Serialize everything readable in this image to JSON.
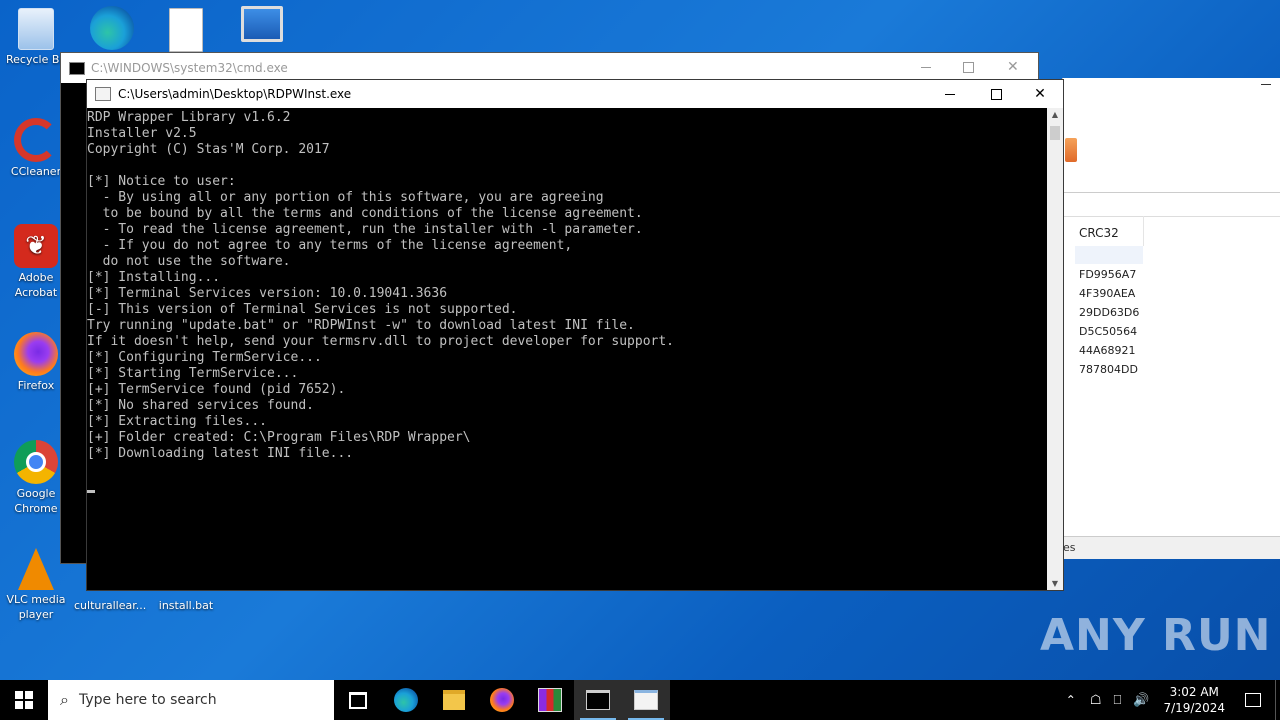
{
  "desktop_icons": [
    {
      "label": "Recycle Bin",
      "icon": "recycle-bin-icon"
    },
    {
      "label": "CCleaner",
      "icon": "ccleaner-icon"
    },
    {
      "label": "Adobe Acrobat",
      "icon": "acrobat-icon"
    },
    {
      "label": "Firefox",
      "icon": "firefox-icon"
    },
    {
      "label": "Google Chrome",
      "icon": "chrome-icon"
    },
    {
      "label": "VLC media player",
      "icon": "vlc-icon"
    },
    {
      "label": "culturallear...",
      "icon": "file-icon"
    },
    {
      "label": "install.bat",
      "icon": "bat-file-icon"
    }
  ],
  "back_window": {
    "title": "C:\\WINDOWS\\system32\\cmd.exe"
  },
  "front_window": {
    "title": "C:\\Users\\admin\\Desktop\\RDPWInst.exe",
    "console_lines": [
      "RDP Wrapper Library v1.6.2",
      "Installer v2.5",
      "Copyright (C) Stas'M Corp. 2017",
      "",
      "[*] Notice to user:",
      "  - By using all or any portion of this software, you are agreeing",
      "  to be bound by all the terms and conditions of the license agreement.",
      "  - To read the license agreement, run the installer with -l parameter.",
      "  - If you do not agree to any terms of the license agreement,",
      "  do not use the software.",
      "[*] Installing...",
      "[*] Terminal Services version: 10.0.19041.3636",
      "[-] This version of Terminal Services is not supported.",
      "Try running \"update.bat\" or \"RDPWInst -w\" to download latest INI file.",
      "If it doesn't help, send your termsrv.dll to project developer for support.",
      "[*] Configuring TermService...",
      "[*] Starting TermService...",
      "[+] TermService found (pid 7652).",
      "[*] No shared services found.",
      "[*] Extracting files...",
      "[+] Folder created: C:\\Program Files\\RDP Wrapper\\",
      "[*] Downloading latest INI file..."
    ]
  },
  "right_window": {
    "column_header": "CRC32",
    "crc_values": [
      "FD9956A7",
      "4F390AEA",
      "29DD63D6",
      "D5C50564",
      "44A68921",
      "787804DD"
    ],
    "status_fragment": "es"
  },
  "taskbar": {
    "search_placeholder": "Type here to search",
    "time": "3:02 AM",
    "date": "7/19/2024"
  },
  "watermark": "ANY RUN"
}
